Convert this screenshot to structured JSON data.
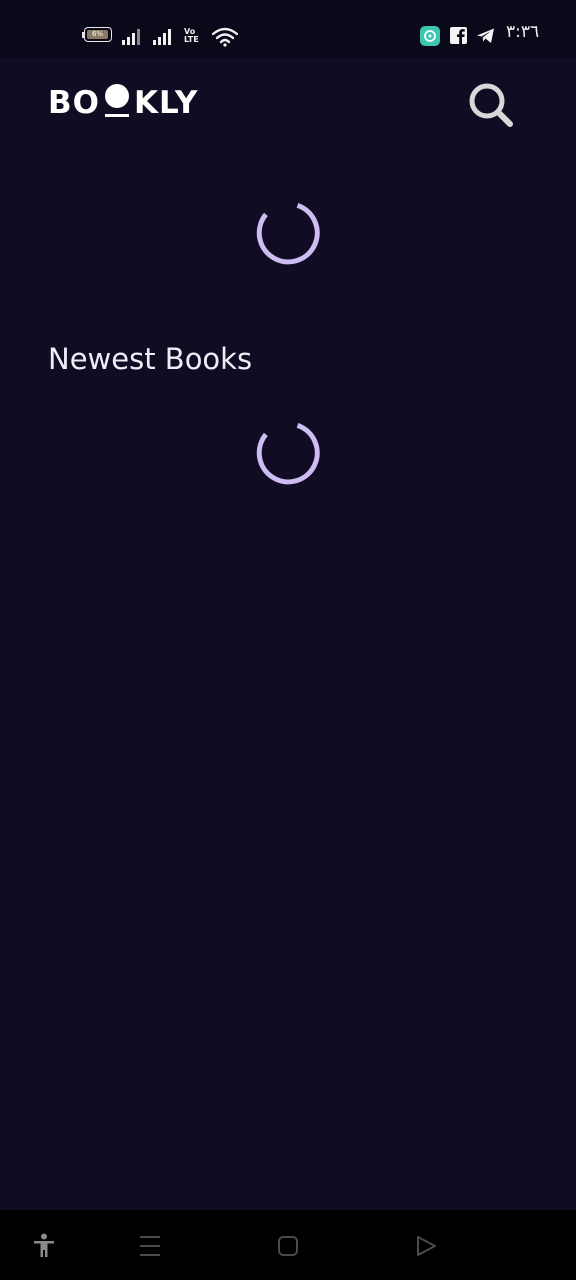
{
  "status_bar": {
    "battery_level": "6%",
    "volte_line1": "Vo",
    "volte_line2": "LTE",
    "time": "٣:٣٦",
    "icons": [
      "battery-icon",
      "signal-icon",
      "signal-icon",
      "volte-icon",
      "wifi-icon",
      "app-notification-icon",
      "facebook-icon",
      "telegram-icon"
    ],
    "colors": {
      "app_badge": "#3ec6b3",
      "battery_fill": "#8a7b62"
    }
  },
  "app_bar": {
    "logo_text": "BOOKLY",
    "logo_parts": {
      "left": "BO",
      "right": "KLY"
    },
    "search_icon": "search-icon"
  },
  "featured_books": {
    "state": "loading",
    "indicator": "loading-spinner"
  },
  "newest_books": {
    "title": "Newest Books",
    "state": "loading",
    "indicator": "loading-spinner"
  },
  "nav_bar": {
    "buttons": [
      "accessibility-icon",
      "menu-icon",
      "home-icon",
      "back-icon"
    ]
  },
  "colors": {
    "background": "#100c23",
    "status_bar": "#0b0819",
    "spinner": "#cdbdf3",
    "text": "#efedf6"
  }
}
